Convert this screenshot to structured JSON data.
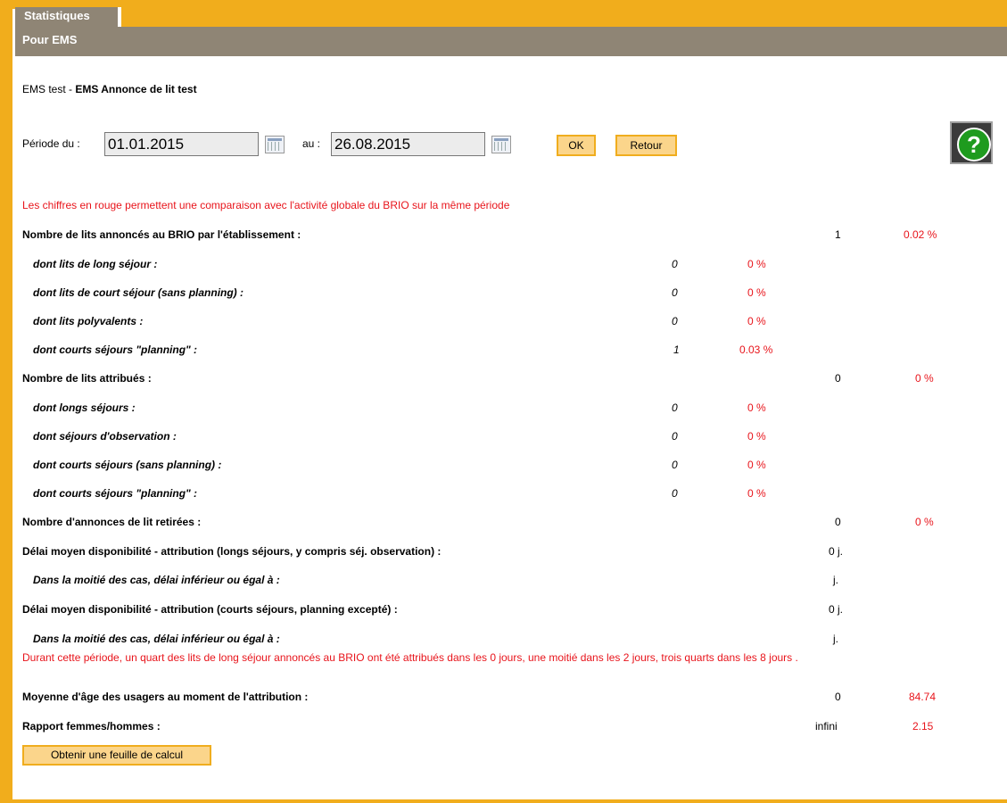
{
  "tab": {
    "label": "Statistiques"
  },
  "section": {
    "title": "Pour EMS"
  },
  "establishment": {
    "prefix": "EMS test - ",
    "name": "EMS Annonce de lit test"
  },
  "period": {
    "from_label": "Période du :",
    "from_value": "01.01.2015",
    "to_label": "au :",
    "to_value": "26.08.2015",
    "ok_label": "OK",
    "back_label": "Retour"
  },
  "help": {
    "glyph": "?"
  },
  "notice": "Les chiffres en rouge permettent une comparaison avec l'activité globale du BRIO sur la même période",
  "rows": [
    {
      "label": "Nombre de lits annoncés au BRIO par l'établissement :",
      "value": "1",
      "pct": "0.02 %"
    },
    {
      "label": "dont lits de long séjour :",
      "value": "0",
      "pct": "0 %"
    },
    {
      "label": "dont lits de court séjour (sans planning) :",
      "value": "0",
      "pct": "0 %"
    },
    {
      "label": "dont lits polyvalents :",
      "value": "0",
      "pct": "0 %"
    },
    {
      "label": "dont courts séjours \"planning\" :",
      "value": "1",
      "pct": "0.03 %"
    },
    {
      "label": "Nombre de lits attribués :",
      "value": "0",
      "pct": "0 %"
    },
    {
      "label": "dont longs séjours :",
      "value": "0",
      "pct": "0 %"
    },
    {
      "label": "dont séjours d'observation :",
      "value": "0",
      "pct": "0 %"
    },
    {
      "label": "dont courts séjours (sans planning) :",
      "value": "0",
      "pct": "0 %"
    },
    {
      "label": "dont courts séjours \"planning\" :",
      "value": "0",
      "pct": "0 %"
    },
    {
      "label": "Nombre d'annonces de lit retirées :",
      "value": "0",
      "pct": "0 %"
    },
    {
      "label": "Délai moyen disponibilité - attribution (longs séjours, y compris séj. observation) :",
      "value": "0 j."
    },
    {
      "label": "Dans la moitié des cas, délai inférieur ou égal à :",
      "value": "j."
    },
    {
      "label": "Délai moyen disponibilité - attribution (courts séjours, planning excepté) :",
      "value": "0 j."
    },
    {
      "label": "Dans la moitié des cas, délai inférieur ou égal à :",
      "value": "j."
    },
    {
      "label": "Moyenne d'âge des usagers au moment de l'attribution :",
      "value": "0",
      "pct": "84.74"
    },
    {
      "label": "Rapport femmes/hommes :",
      "value": "infini",
      "pct": "2.15"
    }
  ],
  "quartile_note": "Durant cette période, un quart des lits de long séjour annoncés au BRIO ont été attribués dans les 0 jours, une moitié dans les 2 jours, trois quarts dans les 8 jours .",
  "export_label": "Obtenir une feuille de calcul",
  "colors": {
    "accent": "#f1ad1c",
    "header": "#8f8575",
    "highlight": "#e8141b",
    "help": "#1e9b1e"
  }
}
